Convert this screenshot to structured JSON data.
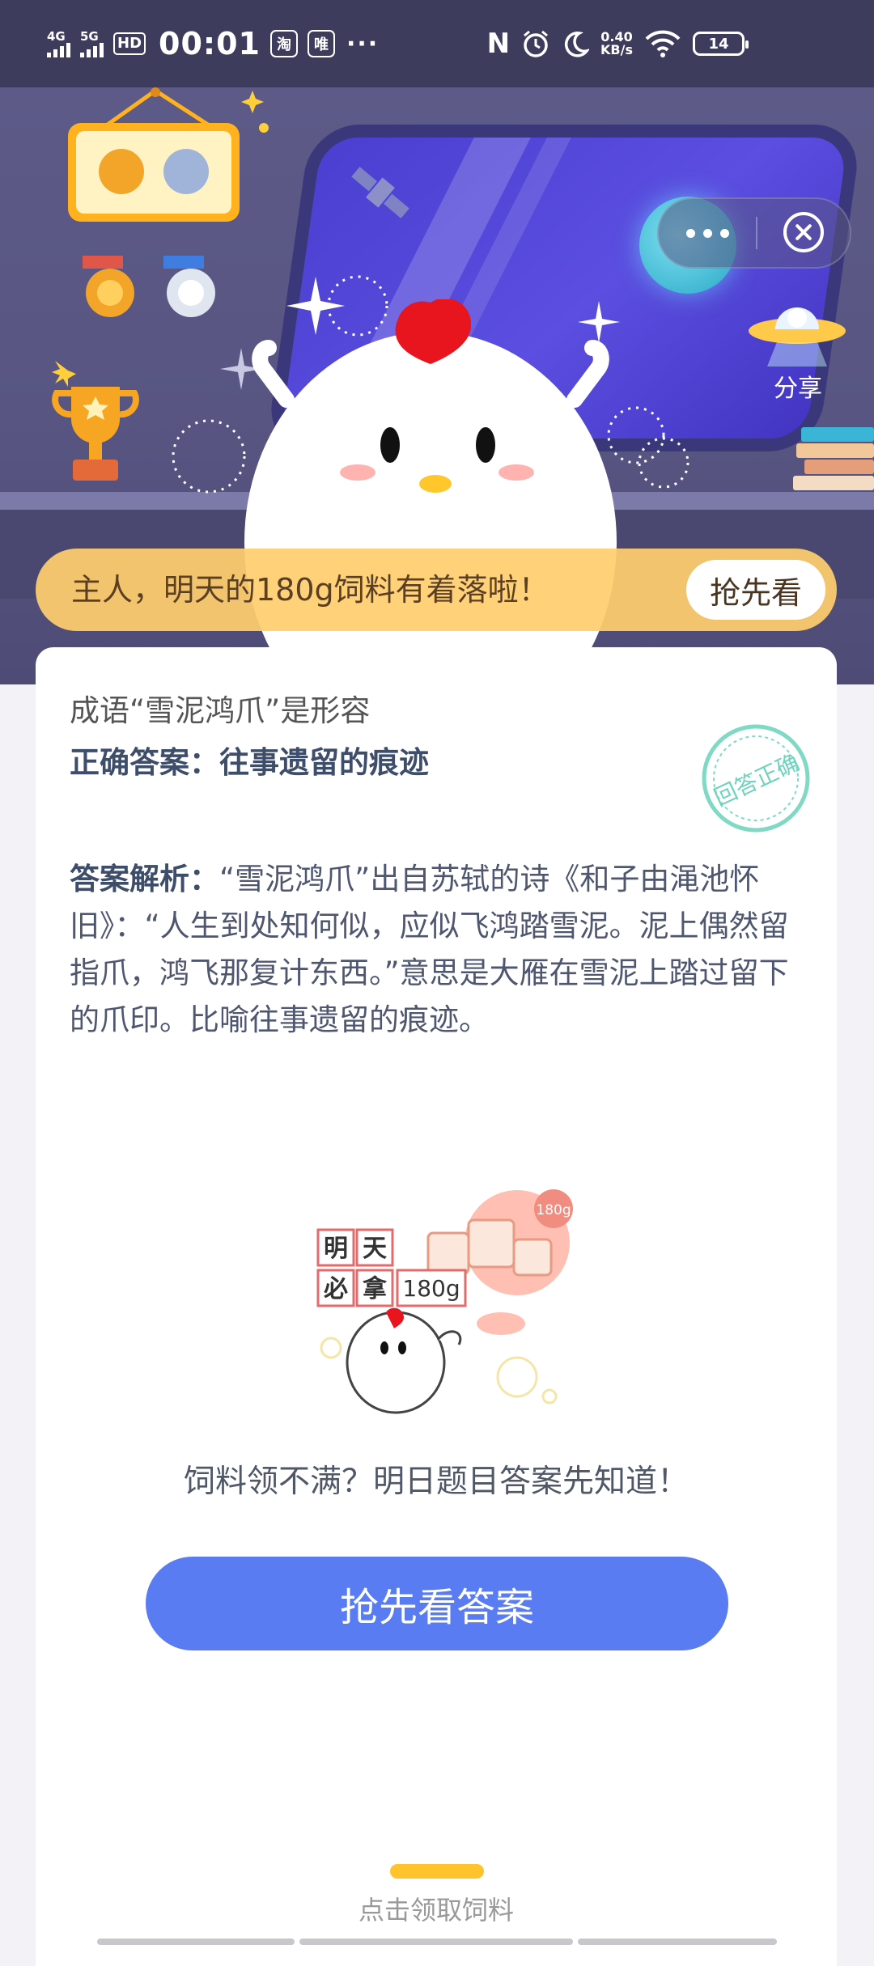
{
  "status_bar": {
    "network1": "4G",
    "network2": "5G",
    "hd_label": "HD",
    "time": "00:01",
    "app_icon_1": "淘",
    "app_icon_2": "唯",
    "more": "···",
    "speed_value": "0.40",
    "speed_unit": "KB/s",
    "battery": "14"
  },
  "header": {
    "share_label": "分享",
    "banner_text": "主人，明天的180g饲料有着落啦！",
    "banner_button": "抢先看",
    "icons": [
      "more-icon",
      "close-icon",
      "ufo-share-icon"
    ]
  },
  "question": {
    "text": "成语“雪泥鸿爪”是形容",
    "answer_label": "正确答案：",
    "answer": "往事遗留的痕迹",
    "stamp_text": "回答正确",
    "explanation_label": "答案解析：",
    "explanation": "“雪泥鸿爪”出自苏轼的诗《和子由渑池怀旧》：“人生到处知何似，应似飞鸿踏雪泥。泥上偶然留指爪，鸿飞那复计东西。”意思是大雁在雪泥上踏过留下的爪印。比喻往事遗留的痕迹。"
  },
  "promo": {
    "chars": [
      "明",
      "天",
      "必",
      "拿"
    ],
    "weight": "180g",
    "bag_label": "180g",
    "text": "饲料领不满？明日题目答案先知道！",
    "cta": "抢先看答案"
  },
  "bottom": {
    "label": "点击领取饲料"
  }
}
